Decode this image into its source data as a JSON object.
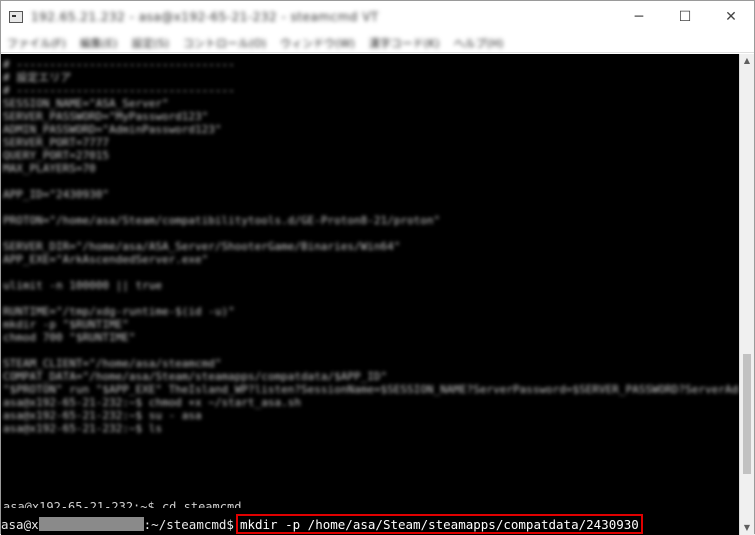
{
  "window": {
    "title": "192.65.21.232 - asa@x192-65-21-232 - steamcmd VT",
    "controls": {
      "minimize": "─",
      "maximize": "☐",
      "close": "✕"
    }
  },
  "menu": {
    "items": [
      "ファイル(F)",
      "編集(E)",
      "設定(S)",
      "コントロール(O)",
      "ウィンドウ(W)",
      "漢字コード(K)",
      "ヘルプ(H)"
    ]
  },
  "terminal": {
    "blurred_lines": [
      "# ---------------------------------",
      "# 設定エリア",
      "# ---------------------------------",
      "SESSION_NAME=\"ASA_Server\"",
      "SERVER_PASSWORD=\"MyPassword123\"",
      "ADMIN_PASSWORD=\"AdminPassword123\"",
      "SERVER_PORT=7777",
      "QUERY_PORT=27015",
      "MAX_PLAYERS=70",
      "",
      "APP_ID=\"2430930\"",
      "",
      "PROTON=\"/home/asa/Steam/compatibilitytools.d/GE-Proton8-21/proton\"",
      "",
      "SERVER_DIR=\"/home/asa/ASA_Server/ShooterGame/Binaries/Win64\"",
      "APP_EXE=\"ArkAscendedServer.exe\"",
      "",
      "ulimit -n 100000 || true",
      "",
      "RUNTIME=\"/tmp/xdg-runtime-$(id -u)\"",
      "mkdir -p \"$RUNTIME\"",
      "chmod 700 \"$RUNTIME\"",
      "",
      "STEAM_CLIENT=\"/home/asa/steamcmd\"",
      "COMPAT_DATA=\"/home/asa/Steam/steamapps/compatdata/$APP_ID\"",
      "\"$PROTON\" run \"$APP_EXE\" TheIsland_WP?listen?SessionName=$SESSION_NAME?ServerPassword=$SERVER_PASSWORD?ServerAdminPassword=$ADMIN_PA",
      "asa@x192-65-21-232:~$ chmod +x ~/start_asa.sh",
      "asa@x192-65-21-232:~$ su - asa",
      "asa@x192-65-21-232:~$ ls"
    ],
    "partial_line": "asa@x192-65-21-232:~$ cd steamcmd",
    "prompt_user": "asa@x",
    "prompt_path": ":~/steamcmd$",
    "command": "mkdir -p /home/asa/Steam/steamapps/compatdata/2430930"
  },
  "colors": {
    "terminal_bg": "#000000",
    "terminal_fg": "#c8c8c8",
    "highlight_border": "#e00000",
    "mask": "#8a8a8a"
  },
  "icons": {
    "app": "terminal-app-icon",
    "scroll_up": "triangle-up",
    "scroll_down": "triangle-down"
  }
}
